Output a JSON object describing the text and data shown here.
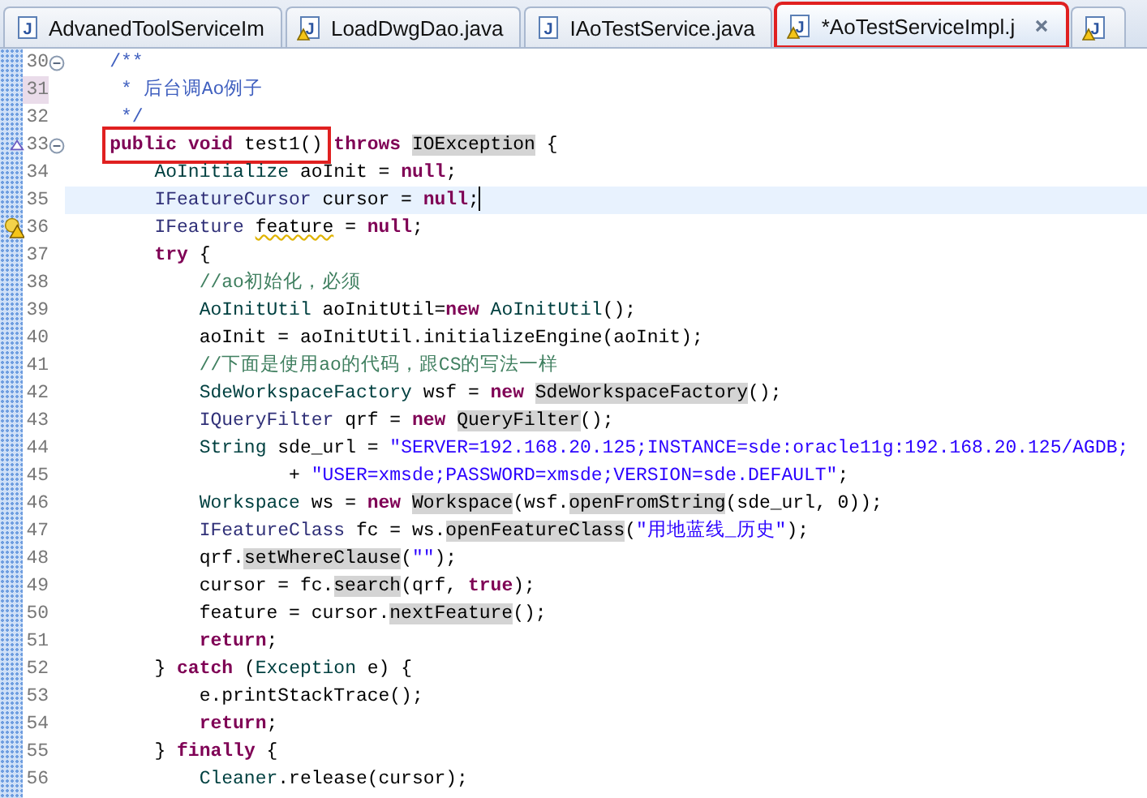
{
  "tabs": [
    {
      "icon_letter": "J",
      "label": "AdvanedToolServiceIm",
      "selected": false,
      "warning": false,
      "boxed": false,
      "closable": false
    },
    {
      "icon_letter": "J",
      "label": "LoadDwgDao.java",
      "selected": false,
      "warning": true,
      "boxed": false,
      "closable": false
    },
    {
      "icon_letter": "J",
      "label": "IAoTestService.java",
      "selected": false,
      "warning": false,
      "boxed": false,
      "closable": false
    },
    {
      "icon_letter": "J",
      "label": "*AoTestServiceImpl.j",
      "selected": true,
      "warning": true,
      "boxed": true,
      "closable": true
    },
    {
      "icon_letter": "J",
      "selected": false,
      "warning": true,
      "boxed": false,
      "closable": false
    }
  ],
  "editor": {
    "lines": [
      {
        "number": "30",
        "foldable": true,
        "tokens": [
          {
            "kind": "javadoc",
            "text": "    /**"
          }
        ]
      },
      {
        "number": "31",
        "flagged": true,
        "tokens": [
          {
            "kind": "javadoc",
            "text": "     * 后台调Ao例子"
          }
        ]
      },
      {
        "number": "32",
        "tokens": [
          {
            "kind": "javadoc",
            "text": "     */"
          }
        ]
      },
      {
        "number": "33",
        "override": true,
        "foldable": true,
        "tokens": [
          {
            "kind": "keyword",
            "text": "    public",
            "boxed": true
          },
          {
            "kind": "keyword",
            "text": " void",
            "boxed": true
          },
          {
            "kind": "plain",
            "text": " test1()",
            "boxed": true
          },
          {
            "kind": "keyword",
            "text": " throws"
          },
          {
            "kind": "mark",
            "text": " IOException"
          },
          {
            "kind": "plain",
            "text": " {"
          }
        ]
      },
      {
        "number": "34",
        "tokens": [
          {
            "kind": "type",
            "text": "        AoInitialize"
          },
          {
            "kind": "plain",
            "text": " aoInit = "
          },
          {
            "kind": "keyword",
            "text": "null"
          },
          {
            "kind": "plain",
            "text": ";"
          }
        ]
      },
      {
        "number": "35",
        "current": true,
        "caret": true,
        "tokens": [
          {
            "kind": "iface",
            "text": "        IFeatureCursor"
          },
          {
            "kind": "plain",
            "text": " cursor = "
          },
          {
            "kind": "keyword",
            "text": "null"
          },
          {
            "kind": "plain",
            "text": ";"
          }
        ]
      },
      {
        "number": "36",
        "warning": true,
        "tokens": [
          {
            "kind": "iface",
            "text": "        IFeature"
          },
          {
            "kind": "warn",
            "text": " feature"
          },
          {
            "kind": "plain",
            "text": " = "
          },
          {
            "kind": "keyword",
            "text": "null"
          },
          {
            "kind": "plain",
            "text": ";"
          }
        ]
      },
      {
        "number": "37",
        "tokens": [
          {
            "kind": "keyword",
            "text": "        try"
          },
          {
            "kind": "plain",
            "text": " {"
          }
        ]
      },
      {
        "number": "38",
        "tokens": [
          {
            "kind": "comment",
            "text": "            //ao初始化，必须"
          }
        ]
      },
      {
        "number": "39",
        "tokens": [
          {
            "kind": "type",
            "text": "            AoInitUtil"
          },
          {
            "kind": "plain",
            "text": " aoInitUtil="
          },
          {
            "kind": "keyword",
            "text": "new"
          },
          {
            "kind": "type",
            "text": " AoInitUtil"
          },
          {
            "kind": "plain",
            "text": "();"
          }
        ]
      },
      {
        "number": "40",
        "tokens": [
          {
            "kind": "plain",
            "text": "            aoInit = aoInitUtil.initializeEngine(aoInit);"
          }
        ]
      },
      {
        "number": "41",
        "tokens": [
          {
            "kind": "comment",
            "text": "            //下面是使用ao的代码，跟CS的写法一样"
          }
        ]
      },
      {
        "number": "42",
        "tokens": [
          {
            "kind": "type",
            "text": "            SdeWorkspaceFactory"
          },
          {
            "kind": "plain",
            "text": " wsf = "
          },
          {
            "kind": "keyword",
            "text": "new"
          },
          {
            "kind": "mark",
            "text": " SdeWorkspaceFactory"
          },
          {
            "kind": "plain",
            "text": "();"
          }
        ]
      },
      {
        "number": "43",
        "tokens": [
          {
            "kind": "iface",
            "text": "            IQueryFilter"
          },
          {
            "kind": "plain",
            "text": " qrf = "
          },
          {
            "kind": "keyword",
            "text": "new"
          },
          {
            "kind": "mark",
            "text": " QueryFilter"
          },
          {
            "kind": "plain",
            "text": "();"
          }
        ]
      },
      {
        "number": "44",
        "tokens": [
          {
            "kind": "type",
            "text": "            String"
          },
          {
            "kind": "plain",
            "text": " sde_url = "
          },
          {
            "kind": "string",
            "text": "\"SERVER=192.168.20.125;INSTANCE=sde:oracle11g:192.168.20.125/AGDB;"
          }
        ]
      },
      {
        "number": "45",
        "tokens": [
          {
            "kind": "plain",
            "text": "                    + "
          },
          {
            "kind": "string",
            "text": "\"USER=xmsde;PASSWORD=xmsde;VERSION=sde.DEFAULT\""
          },
          {
            "kind": "plain",
            "text": ";"
          }
        ]
      },
      {
        "number": "46",
        "tokens": [
          {
            "kind": "type",
            "text": "            Workspace"
          },
          {
            "kind": "plain",
            "text": " ws = "
          },
          {
            "kind": "keyword",
            "text": "new"
          },
          {
            "kind": "mark",
            "text": " Workspace"
          },
          {
            "kind": "plain",
            "text": "(wsf."
          },
          {
            "kind": "mark",
            "text": "openFromString"
          },
          {
            "kind": "plain",
            "text": "(sde_url, 0));"
          }
        ]
      },
      {
        "number": "47",
        "tokens": [
          {
            "kind": "iface",
            "text": "            IFeatureClass"
          },
          {
            "kind": "plain",
            "text": " fc = ws."
          },
          {
            "kind": "mark",
            "text": "openFeatureClass"
          },
          {
            "kind": "plain",
            "text": "("
          },
          {
            "kind": "string",
            "text": "\"用地蓝线_历史\""
          },
          {
            "kind": "plain",
            "text": ");"
          }
        ]
      },
      {
        "number": "48",
        "tokens": [
          {
            "kind": "plain",
            "text": "            qrf."
          },
          {
            "kind": "mark",
            "text": "setWhereClause"
          },
          {
            "kind": "plain",
            "text": "("
          },
          {
            "kind": "string",
            "text": "\"\""
          },
          {
            "kind": "plain",
            "text": ");"
          }
        ]
      },
      {
        "number": "49",
        "tokens": [
          {
            "kind": "plain",
            "text": "            cursor = fc."
          },
          {
            "kind": "mark",
            "text": "search"
          },
          {
            "kind": "plain",
            "text": "(qrf, "
          },
          {
            "kind": "keyword",
            "text": "true"
          },
          {
            "kind": "plain",
            "text": ");"
          }
        ]
      },
      {
        "number": "50",
        "tokens": [
          {
            "kind": "plain",
            "text": "            feature = cursor."
          },
          {
            "kind": "mark",
            "text": "nextFeature"
          },
          {
            "kind": "plain",
            "text": "();"
          }
        ]
      },
      {
        "number": "51",
        "tokens": [
          {
            "kind": "keyword",
            "text": "            return"
          },
          {
            "kind": "plain",
            "text": ";"
          }
        ]
      },
      {
        "number": "52",
        "tokens": [
          {
            "kind": "plain",
            "text": "        } "
          },
          {
            "kind": "keyword",
            "text": "catch"
          },
          {
            "kind": "plain",
            "text": " ("
          },
          {
            "kind": "type",
            "text": "Exception"
          },
          {
            "kind": "plain",
            "text": " e) {"
          }
        ]
      },
      {
        "number": "53",
        "tokens": [
          {
            "kind": "plain",
            "text": "            e.printStackTrace();"
          }
        ]
      },
      {
        "number": "54",
        "tokens": [
          {
            "kind": "keyword",
            "text": "            return"
          },
          {
            "kind": "plain",
            "text": ";"
          }
        ]
      },
      {
        "number": "55",
        "tokens": [
          {
            "kind": "plain",
            "text": "        } "
          },
          {
            "kind": "keyword",
            "text": "finally"
          },
          {
            "kind": "plain",
            "text": " {"
          }
        ]
      },
      {
        "number": "56",
        "tokens": [
          {
            "kind": "type",
            "text": "            Cleaner"
          },
          {
            "kind": "plain",
            "text": ".release(cursor);"
          }
        ]
      }
    ]
  }
}
